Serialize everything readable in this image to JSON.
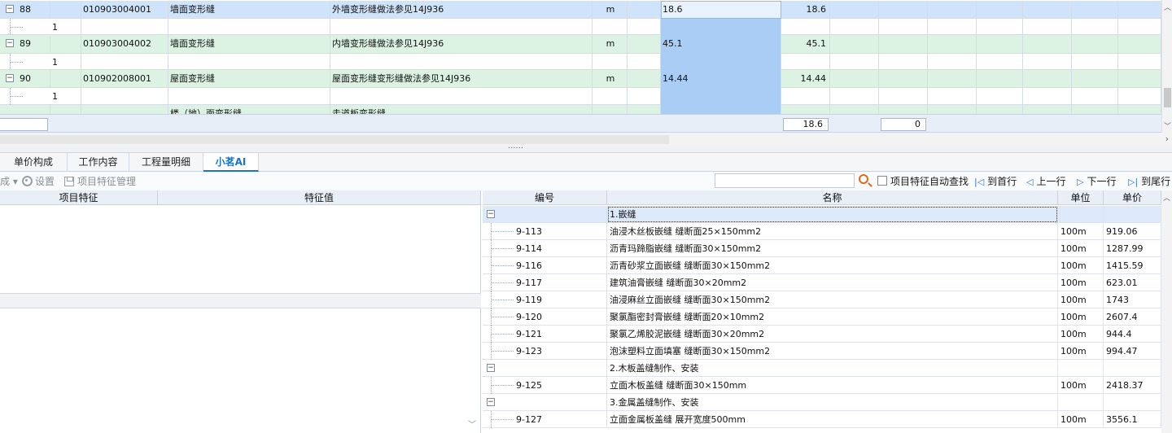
{
  "top_grid": {
    "rows": [
      {
        "kind": "main",
        "selected": true,
        "seq": "88",
        "code": "010903004001",
        "name": "墙面变形缝",
        "feature": "外墙变形缝做法参见14J936",
        "unit": "m",
        "qty_expr": "18.6",
        "qty": "18.6"
      },
      {
        "kind": "sub",
        "seq": "1"
      },
      {
        "kind": "main",
        "selected": false,
        "seq": "89",
        "code": "010903004002",
        "name": "墙面变形缝",
        "feature": "内墙变形缝做法参见14J936",
        "unit": "m",
        "qty_expr": "45.1",
        "qty": "45.1"
      },
      {
        "kind": "sub",
        "seq": "1"
      },
      {
        "kind": "main",
        "selected": false,
        "seq": "90",
        "code": "010902008001",
        "name": "屋面变形缝",
        "feature": "屋面变形缝变形缝做法参见14J936",
        "unit": "m",
        "qty_expr": "14.44",
        "qty": "14.44"
      },
      {
        "kind": "sub",
        "seq": "1"
      },
      {
        "kind": "partial",
        "seq": "",
        "code": "",
        "name": "楼（地）面变形缝",
        "feature": "走道板变形缝",
        "unit": "",
        "qty_expr": "",
        "qty": ""
      }
    ],
    "summary": {
      "total_qty": "18.6",
      "zero_value": "0"
    }
  },
  "tabs": [
    "单价构成",
    "工作内容",
    "工程量明细",
    "小茗AI"
  ],
  "active_tab": 3,
  "toolbar": {
    "leading_fragment": "成 ▾",
    "settings_label": "设置",
    "feature_manage_label": "项目特征管理",
    "search_placeholder": "",
    "auto_find_label": "项目特征自动查找",
    "to_first_label": "到首行",
    "prev_label": "上一行",
    "next_label": "下一行",
    "to_last_label": "到尾行"
  },
  "left_table": {
    "col_feature": "项目特征",
    "col_value": "特征值"
  },
  "right_table": {
    "headers": {
      "code": "编号",
      "name": "名称",
      "unit": "单位",
      "price": "单价"
    },
    "rows": [
      {
        "kind": "group",
        "selected": true,
        "code": "",
        "name": "1.嵌缝",
        "unit": "",
        "price": ""
      },
      {
        "kind": "item",
        "code": "9-113",
        "name": "油浸木丝板嵌缝 缝断面25×150mm2",
        "unit": "100m",
        "price": "919.06"
      },
      {
        "kind": "item",
        "code": "9-114",
        "name": "沥青玛蹄脂嵌缝 缝断面30×150mm2",
        "unit": "100m",
        "price": "1287.99"
      },
      {
        "kind": "item",
        "code": "9-116",
        "name": "沥青砂浆立面嵌缝 缝断面30×150mm2",
        "unit": "100m",
        "price": "1415.59"
      },
      {
        "kind": "item",
        "code": "9-117",
        "name": "建筑油膏嵌缝 缝断面30×20mm2",
        "unit": "100m",
        "price": "623.01"
      },
      {
        "kind": "item",
        "code": "9-119",
        "name": "油浸麻丝立面嵌缝 缝断面30×150mm2",
        "unit": "100m",
        "price": "1743"
      },
      {
        "kind": "item",
        "code": "9-120",
        "name": "聚氯酯密封膏嵌缝 缝断面20×10mm2",
        "unit": "100m",
        "price": "2607.4"
      },
      {
        "kind": "item",
        "code": "9-121",
        "name": "聚氯乙烯胶泥嵌缝 缝断面30×20mm2",
        "unit": "100m",
        "price": "944.4"
      },
      {
        "kind": "item",
        "code": "9-123",
        "name": "泡沫塑料立面填塞 缝断面30×150mm2",
        "unit": "100m",
        "price": "994.47"
      },
      {
        "kind": "group",
        "selected": false,
        "code": "",
        "name": "2.木板盖缝制作、安装",
        "unit": "",
        "price": ""
      },
      {
        "kind": "item",
        "code": "9-125",
        "name": "立面木板盖缝 缝断面30×150mm",
        "unit": "100m",
        "price": "2418.37"
      },
      {
        "kind": "group",
        "selected": false,
        "code": "",
        "name": "3.金属盖缝制作、安装",
        "unit": "",
        "price": ""
      },
      {
        "kind": "item",
        "code": "9-127",
        "name": "立面金属板盖缝 展开宽度500mm",
        "unit": "100m",
        "price": "3556.1"
      }
    ]
  },
  "colors": {
    "main_row": "#dcf2e3",
    "selected_row": "#cfe4fb",
    "qty_highlight": "#a9cdf5",
    "accent": "#1e73c8"
  }
}
